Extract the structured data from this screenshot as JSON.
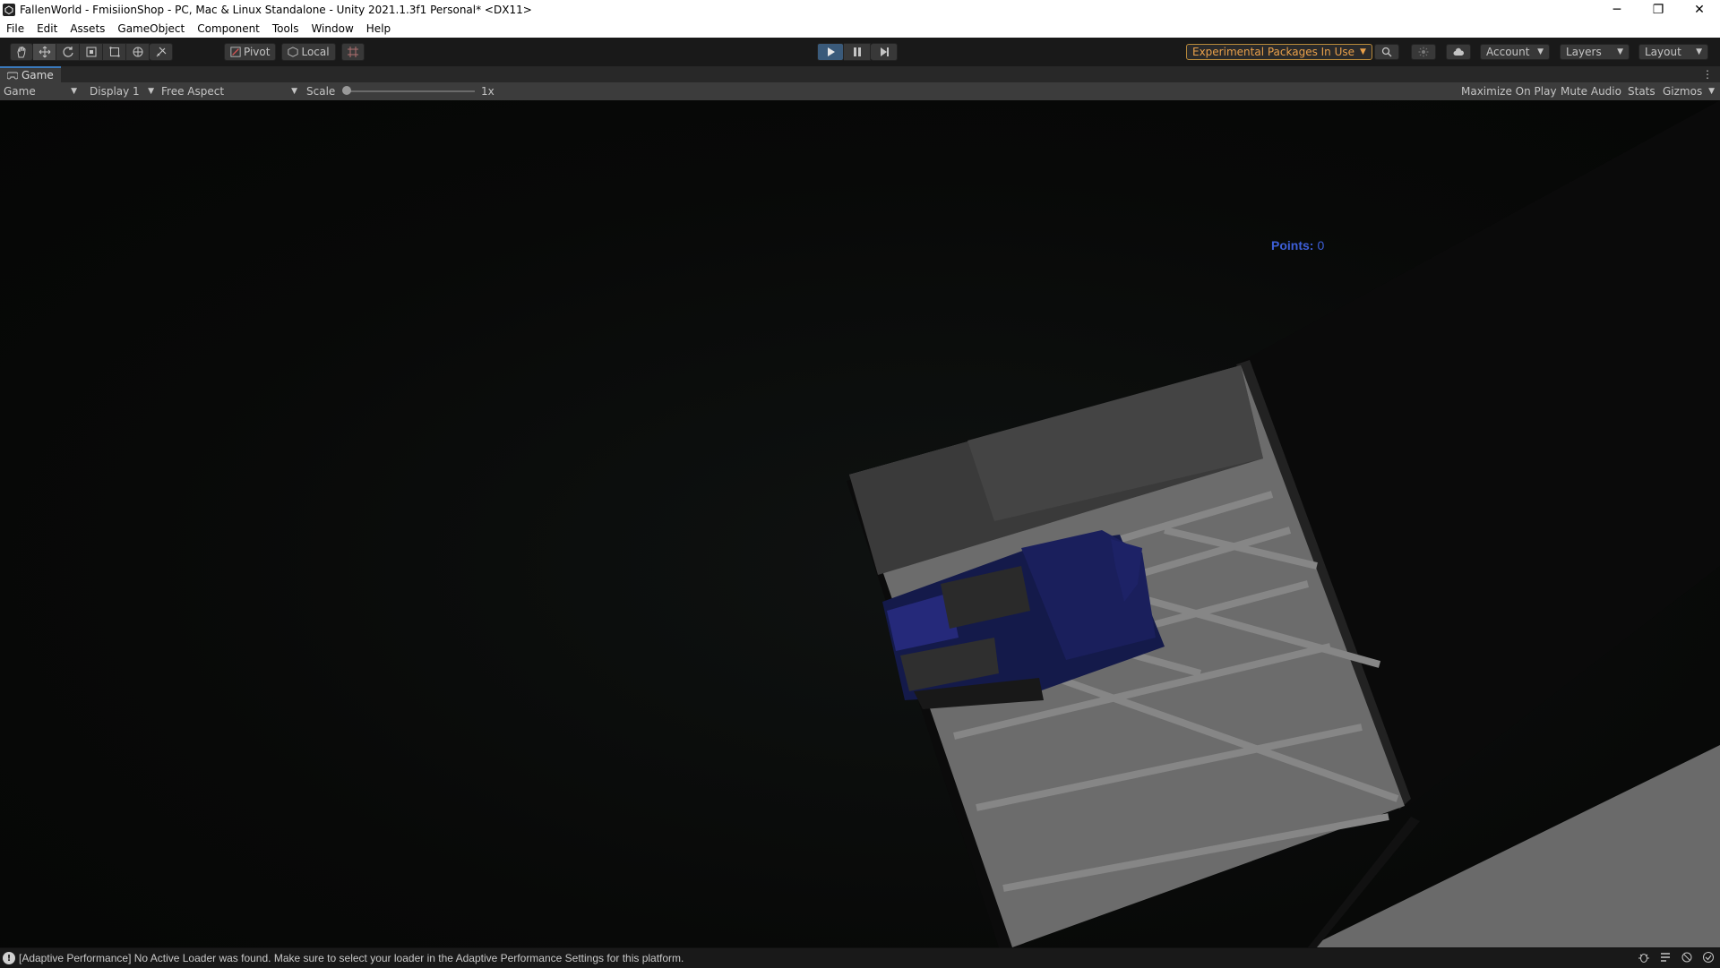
{
  "window": {
    "title": "FallenWorld - FmisiionShop - PC, Mac & Linux Standalone - Unity 2021.1.3f1 Personal* <DX11>",
    "minimize_glyph": "─",
    "restore_glyph": "❐",
    "close_glyph": "✕"
  },
  "menu": [
    "File",
    "Edit",
    "Assets",
    "GameObject",
    "Component",
    "Tools",
    "Window",
    "Help"
  ],
  "toolbar": {
    "pivot_label": "Pivot",
    "local_label": "Local",
    "experimental_label": "Experimental Packages In Use",
    "account_label": "Account",
    "layers_label": "Layers",
    "layout_label": "Layout"
  },
  "game_view": {
    "tab_label": "Game",
    "view_select": "Game",
    "display_select": "Display 1",
    "aspect_select": "Free Aspect",
    "scale_label": "Scale",
    "scale_value": "1x",
    "scale_fraction": 0,
    "maximize_label": "Maximize On Play",
    "mute_label": "Mute Audio",
    "stats_label": "Stats",
    "gizmos_label": "Gizmos"
  },
  "hud": {
    "points_label": "Points:",
    "points_value": "0"
  },
  "status": {
    "message": "[Adaptive Performance] No Active Loader was found. Make sure to select your loader in the Adaptive Performance Settings for this platform."
  },
  "colors": {
    "accent": "#3a79bb",
    "points_text": "#3d5fd8",
    "experimental_text": "#e9a04a"
  }
}
